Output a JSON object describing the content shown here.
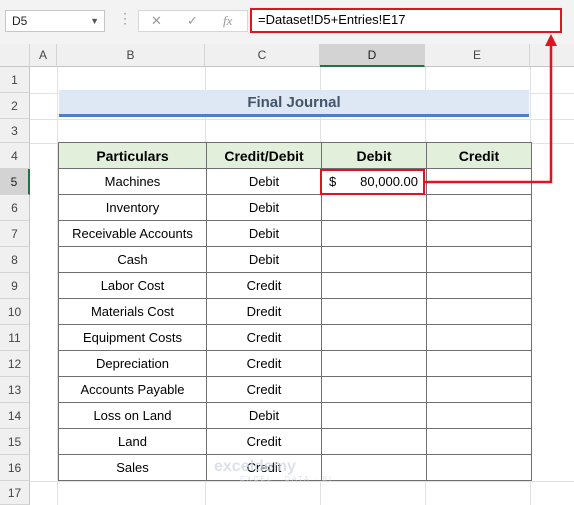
{
  "formula_bar": {
    "name_box": "D5",
    "cancel_icon": "✕",
    "enter_icon": "✓",
    "function_icon": "fx",
    "formula": "=Dataset!D5+Entries!E17"
  },
  "columns": [
    "A",
    "B",
    "C",
    "D",
    "E"
  ],
  "rows": [
    "1",
    "2",
    "3",
    "4",
    "5",
    "6",
    "7",
    "8",
    "9",
    "10",
    "11",
    "12",
    "13",
    "14",
    "15",
    "16",
    "17"
  ],
  "title": "Final Journal",
  "table": {
    "headers": [
      "Particulars",
      "Credit/Debit",
      "Debit",
      "Credit"
    ],
    "rows": [
      {
        "particulars": "Machines",
        "type": "Debit"
      },
      {
        "particulars": "Inventory",
        "type": "Debit"
      },
      {
        "particulars": "Receivable Accounts",
        "type": "Debit"
      },
      {
        "particulars": "Cash",
        "type": "Debit"
      },
      {
        "particulars": "Labor Cost",
        "type": "Credit"
      },
      {
        "particulars": "Materials Cost",
        "type": "Dredit"
      },
      {
        "particulars": "Equipment Costs",
        "type": "Credit"
      },
      {
        "particulars": "Depreciation",
        "type": "Credit"
      },
      {
        "particulars": "Accounts Payable",
        "type": "Credit"
      },
      {
        "particulars": "Loss on Land",
        "type": "Debit"
      },
      {
        "particulars": "Land",
        "type": "Credit"
      },
      {
        "particulars": "Sales",
        "type": "Credit"
      }
    ],
    "selected_cell": {
      "currency": "$",
      "amount": "80,000.00"
    }
  },
  "annotation_color": "#e0141e",
  "header_fill": "#e2efda",
  "watermark": {
    "name": "exceldemy",
    "tagline": "EXCEL · DATA · BI"
  }
}
